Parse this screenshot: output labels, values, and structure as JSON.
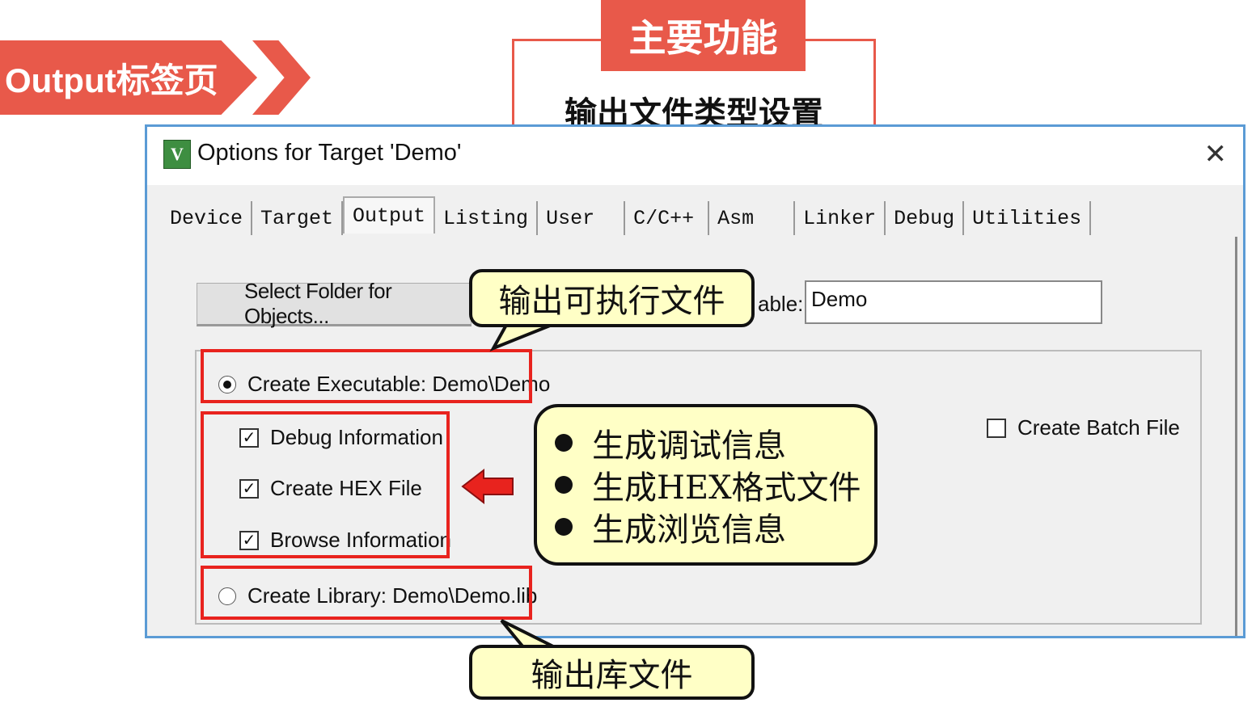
{
  "ribbon": {
    "label": "Output标签页"
  },
  "main_function": {
    "tag": "主要功能",
    "description": "输出文件类型设置"
  },
  "dialog": {
    "title": "Options for Target 'Demo'",
    "icon": "keil-uvision-icon",
    "close_icon": "close-icon",
    "tabs": [
      {
        "label": "Device",
        "active": false
      },
      {
        "label": "Target",
        "active": false
      },
      {
        "label": "Output",
        "active": true
      },
      {
        "label": "Listing",
        "active": false
      },
      {
        "label": "User  ",
        "active": false
      },
      {
        "label": "C/C++  ",
        "active": false
      },
      {
        "label": "Asm  ",
        "active": false
      },
      {
        "label": "Linker",
        "active": false
      },
      {
        "label": "Debug",
        "active": false
      },
      {
        "label": "Utilities",
        "active": false
      }
    ],
    "select_folder_label": "Select Folder for Objects...",
    "name_label": "able:",
    "name_value": "Demo",
    "create_executable": {
      "label": "Create Executable:  Demo\\Demo",
      "selected": true
    },
    "debug_information": {
      "label": "Debug Information",
      "checked": true
    },
    "create_hex": {
      "label": "Create HEX File",
      "checked": true
    },
    "browse_information": {
      "label": "Browse Information",
      "checked": true
    },
    "create_library": {
      "label": "Create Library:  Demo\\Demo.lib",
      "selected": false
    },
    "create_batch": {
      "label": "Create Batch File",
      "checked": false
    }
  },
  "callouts": {
    "executable": "输出可执行文件",
    "library": "输出库文件",
    "bullets": [
      "生成调试信息",
      "生成HEX格式文件",
      "生成浏览信息"
    ]
  },
  "colors": {
    "accent": "#e8594a",
    "highlight": "#e8231e",
    "callout_bg": "#ffffc6",
    "dialog_border": "#5b9bd5"
  }
}
